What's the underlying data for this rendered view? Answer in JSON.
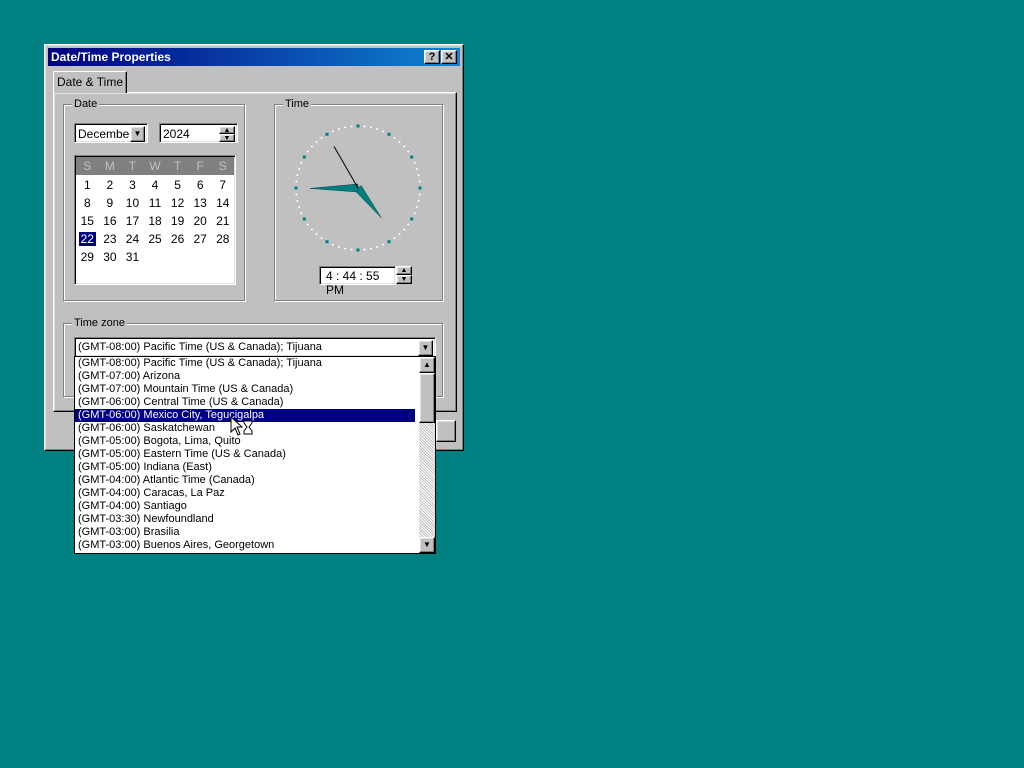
{
  "window": {
    "title": "Date/Time Properties",
    "help_btn": "?",
    "close_btn": "✕"
  },
  "tab": {
    "label": "Date & Time"
  },
  "date_group": {
    "legend": "Date",
    "month": "December",
    "year": "2024",
    "weekdays": [
      "S",
      "M",
      "T",
      "W",
      "T",
      "F",
      "S"
    ],
    "weeks": [
      [
        "1",
        "2",
        "3",
        "4",
        "5",
        "6",
        "7"
      ],
      [
        "8",
        "9",
        "10",
        "11",
        "12",
        "13",
        "14"
      ],
      [
        "15",
        "16",
        "17",
        "18",
        "19",
        "20",
        "21"
      ],
      [
        "22",
        "23",
        "24",
        "25",
        "26",
        "27",
        "28"
      ],
      [
        "29",
        "30",
        "31",
        "",
        "",
        "",
        ""
      ]
    ],
    "selected_day": "22"
  },
  "time_group": {
    "legend": "Time",
    "time_value": "4 : 44 : 55 PM"
  },
  "timezone_group": {
    "legend": "Time zone",
    "selected": "(GMT-08:00) Pacific Time (US & Canada); Tijuana",
    "highlighted_index": 4,
    "options": [
      "(GMT-08:00) Pacific Time (US & Canada); Tijuana",
      "(GMT-07:00) Arizona",
      "(GMT-07:00) Mountain Time (US & Canada)",
      "(GMT-06:00) Central Time (US & Canada)",
      "(GMT-06:00) Mexico City, Tegucigalpa",
      "(GMT-06:00) Saskatchewan",
      "(GMT-05:00) Bogota, Lima, Quito",
      "(GMT-05:00) Eastern Time (US & Canada)",
      "(GMT-05:00) Indiana (East)",
      "(GMT-04:00) Atlantic Time (Canada)",
      "(GMT-04:00) Caracas, La Paz",
      "(GMT-04:00) Santiago",
      "(GMT-03:30) Newfoundland",
      "(GMT-03:00) Brasilia",
      "(GMT-03:00) Buenos Aires, Georgetown"
    ]
  },
  "colors": {
    "desktop": "#008080",
    "titlebar": "#000080",
    "face": "#c0c0c0",
    "highlight": "#000080",
    "clock_hand": "#008080"
  }
}
